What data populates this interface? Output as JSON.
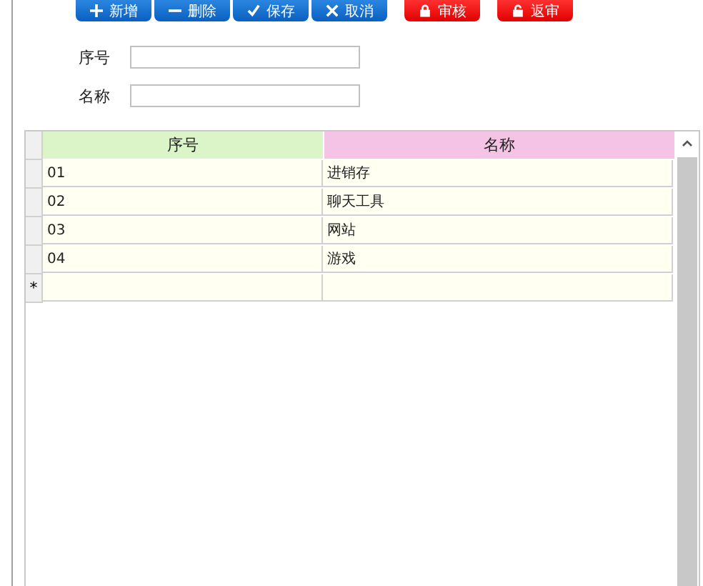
{
  "toolbar": [
    {
      "label": "新增",
      "kind": "primary"
    },
    {
      "label": "删除",
      "kind": "primary"
    },
    {
      "label": "保存",
      "kind": "primary"
    },
    {
      "label": "取消",
      "kind": "primary"
    },
    {
      "label": "审核",
      "kind": "danger"
    },
    {
      "label": "返审",
      "kind": "danger"
    }
  ],
  "form": [
    {
      "label": "序号"
    },
    {
      "label": "名称"
    }
  ],
  "table": {
    "columns": [
      {
        "label": "序号",
        "color": "#dcf5c8"
      },
      {
        "label": "名称",
        "color": "#f5c3e6"
      }
    ],
    "rows": [
      [
        "01",
        "进销存"
      ],
      [
        "02",
        "聊天工具"
      ],
      [
        "03",
        "网站"
      ],
      [
        "04",
        "游戏"
      ]
    ],
    "new_row_marker": "*"
  }
}
